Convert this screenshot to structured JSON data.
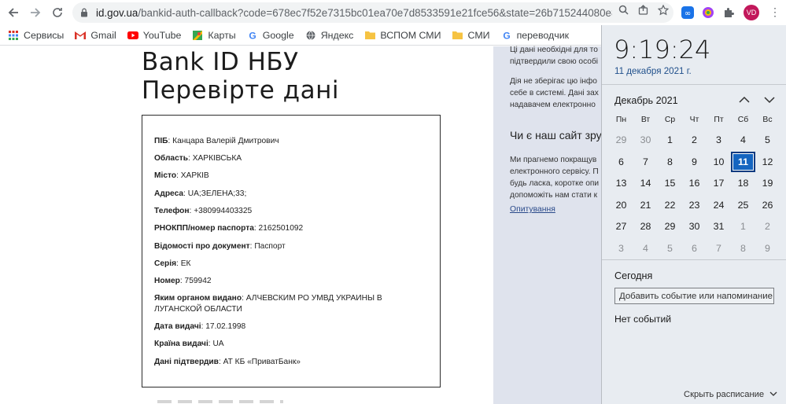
{
  "browser": {
    "url_host": "id.gov.ua",
    "url_path": "/bankid-auth-callback?code=678ec7f52e7315bc01ea70e7d8533591e21fce56&state=26b715244080e8e25006d36d...",
    "avatar_initials": "VD"
  },
  "bookmarks": [
    {
      "label": "Сервисы",
      "icon": "apps-grid-icon",
      "color": "#d93025"
    },
    {
      "label": "Gmail",
      "icon": "gmail-icon",
      "color": "#d93025"
    },
    {
      "label": "YouTube",
      "icon": "youtube-icon",
      "color": "#ff0000"
    },
    {
      "label": "Карты",
      "icon": "maps-icon",
      "color": "#34a853"
    },
    {
      "label": "Google",
      "icon": "google-icon",
      "color": "#4285f4"
    },
    {
      "label": "Яндекс",
      "icon": "globe-icon",
      "color": "#5f6368"
    },
    {
      "label": "ВСПОМ СМИ",
      "icon": "folder-icon",
      "color": "#f6c342"
    },
    {
      "label": "СМИ",
      "icon": "folder-icon",
      "color": "#f6c342"
    },
    {
      "label": "переводчик",
      "icon": "google-icon",
      "color": "#4285f4"
    }
  ],
  "main": {
    "title_line1": "Bank ID НБУ",
    "title_line2": "Перевірте дані",
    "fields": [
      {
        "label": "ПІБ",
        "value": "Канцара Валерій Дмитрович"
      },
      {
        "label": "Область",
        "value": "ХАРКІВСЬКА"
      },
      {
        "label": "Місто",
        "value": "ХАРКІВ"
      },
      {
        "label": "Адреса",
        "value": "UA;ЗЕЛЕНА;33;"
      },
      {
        "label": "Телефон",
        "value": "+380994403325"
      },
      {
        "label": "РНОКПП/номер паспорта",
        "value": "2162501092"
      },
      {
        "label": "Відомості про документ",
        "value": "Паспорт"
      },
      {
        "label": "Серія",
        "value": "ЕК"
      },
      {
        "label": "Номер",
        "value": "759942"
      },
      {
        "label": "Яким органом видано",
        "value": "АЛЧЕВСКИМ РО УМВД УКРАИНЫ В",
        "value2": "ЛУГАНСКОЙ ОБЛАСТИ"
      },
      {
        "label": "Дата видачі",
        "value": "17.02.1998"
      },
      {
        "label": "Країна видачі",
        "value": "UA"
      },
      {
        "label": "Дані підтвердив",
        "value": "АТ КБ «ПриватБанк»"
      }
    ]
  },
  "side": {
    "para1_line1": "Ці дані необхідні для то",
    "para1_line2": "підтвердили свою особі",
    "para2_line1": "Дія не зберігає цю інфо",
    "para2_line2": "себе в системі. Дані зах",
    "para2_line3": "надавачем електронно",
    "question": "Чи є наш сайт зруч",
    "para3_line1": "Ми прагнемо покращув",
    "para3_line2": "електронного сервісу. П",
    "para3_line3": "будь ласка, коротке опи",
    "para3_line4": "допоможіть нам стати к",
    "survey_link": "Опитування"
  },
  "calendar": {
    "time": "9:19:24",
    "date": "11 декабря 2021 г.",
    "month": "Декабрь 2021",
    "weekdays": [
      "Пн",
      "Вт",
      "Ср",
      "Чт",
      "Пт",
      "Сб",
      "Вс"
    ],
    "days": [
      [
        "29",
        "30",
        "1",
        "2",
        "3",
        "4",
        "5"
      ],
      [
        "6",
        "7",
        "8",
        "9",
        "10",
        "11",
        "12"
      ],
      [
        "13",
        "14",
        "15",
        "16",
        "17",
        "18",
        "19"
      ],
      [
        "20",
        "21",
        "22",
        "23",
        "24",
        "25",
        "26"
      ],
      [
        "27",
        "28",
        "29",
        "30",
        "31",
        "1",
        "2"
      ],
      [
        "3",
        "4",
        "5",
        "6",
        "7",
        "8",
        "9"
      ]
    ],
    "selected_day": "11",
    "today_label": "Сегодня",
    "event_placeholder": "Добавить событие или напоминание",
    "no_events": "Нет событий",
    "hide_schedule": "Скрыть расписание"
  },
  "colors": {
    "accent": "#1565c0",
    "side_panel_bg": "#dfe3ed",
    "flyout_bg": "#e8ecf1"
  }
}
